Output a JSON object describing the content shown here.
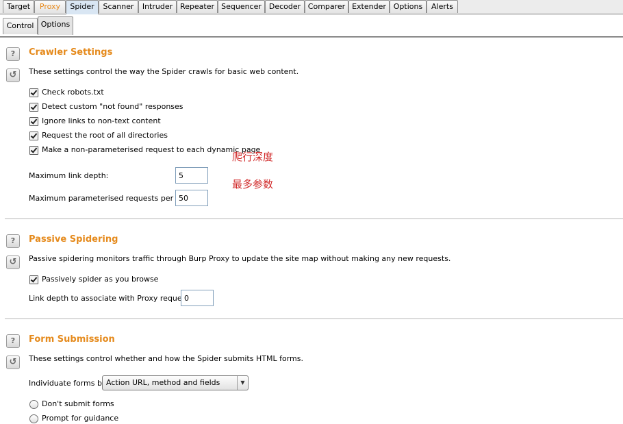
{
  "top_tabs": [
    "Target",
    "Proxy",
    "Spider",
    "Scanner",
    "Intruder",
    "Repeater",
    "Sequencer",
    "Decoder",
    "Comparer",
    "Extender",
    "Options",
    "Alerts"
  ],
  "active_top_tab": "Spider",
  "sub_tabs": [
    "Control",
    "Options"
  ],
  "active_sub_tab": "Options",
  "crawler": {
    "title": "Crawler Settings",
    "description": "These settings control the way the Spider crawls for basic web content.",
    "checkboxes": [
      {
        "label": "Check robots.txt",
        "checked": true
      },
      {
        "label": "Detect custom \"not found\" responses",
        "checked": true
      },
      {
        "label": "Ignore links to non-text content",
        "checked": true
      },
      {
        "label": "Request the root of all directories",
        "checked": true
      },
      {
        "label": "Make a non-parameterised request to each dynamic page",
        "checked": true
      }
    ],
    "max_link_depth_label": "Maximum link depth:",
    "max_link_depth_value": "5",
    "max_param_label": "Maximum parameterised requests per URL:",
    "max_param_value": "50",
    "annotation_depth": "爬行深度",
    "annotation_params": "最多参数"
  },
  "passive": {
    "title": "Passive Spidering",
    "description": "Passive spidering monitors traffic through Burp Proxy to update the site map without making any new requests.",
    "checkbox": {
      "label": "Passively spider as you browse",
      "checked": true
    },
    "link_depth_label": "Link depth to associate with Proxy requests:",
    "link_depth_value": "0"
  },
  "form": {
    "title": "Form Submission",
    "description": "These settings control whether and how the Spider submits HTML forms.",
    "individuate_label": "Individuate forms by:",
    "individuate_value": "Action URL, method and fields",
    "radios": [
      "Don't submit forms",
      "Prompt for guidance"
    ]
  },
  "icons": {
    "help": "?",
    "reset": "↺",
    "dropdown": "▼"
  },
  "colors": {
    "section_title": "#e58a1c",
    "proxy_tab": "#e8891a",
    "annotation": "#d12b2b"
  }
}
